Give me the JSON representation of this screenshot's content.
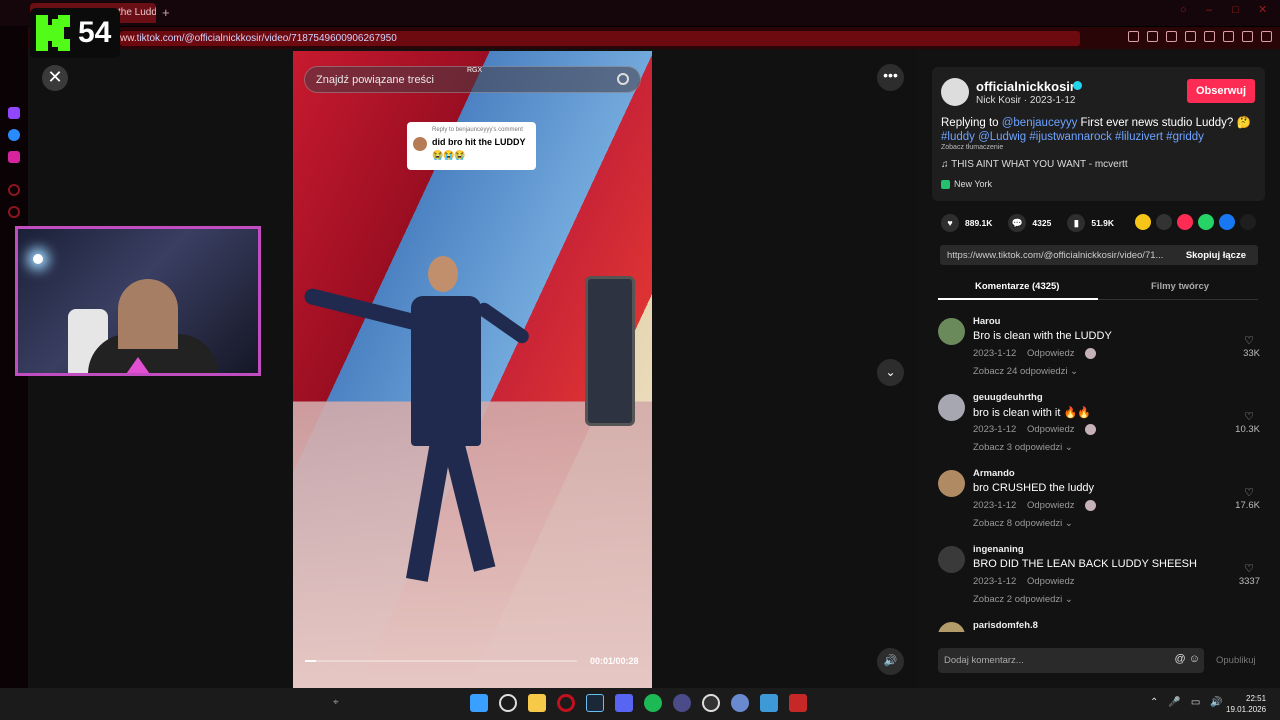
{
  "browser": {
    "tab_title": "the Ludd",
    "url_prefix": "ww.",
    "url_host": "tiktok.com",
    "url_path": "/@officialnickkosir/video/7187549600906267950"
  },
  "overlay": {
    "logo_number": "54"
  },
  "video": {
    "search_placeholder": "Znajdź powiązane treści",
    "search_tag": "RGX",
    "reply_to": "Reply to benjaunceyyy's comment",
    "reply_text": "did bro hit the LUDDY",
    "reply_emoji": "😭😭😭",
    "time": "00:01/00:28",
    "progress": 0.04,
    "close_label": "✕",
    "more_label": "•••",
    "down_label": "⌄",
    "volume_label": "🔊"
  },
  "post": {
    "username": "officialnickkosir",
    "subline": "Nick Kosir · 2023-1-12",
    "follow_label": "Obserwuj",
    "caption_plain": "Replying to ",
    "caption_mention": "@benjauceyyy",
    "caption_rest": " First ever news studio Luddy? 🤔",
    "caption_tags": "#luddy @Ludwig #ijustwannarock #liluzivert #griddy",
    "translate_label": "Zobacz tłumaczenie",
    "music": "♫  THIS AINT WHAT YOU WANT - mcvertt",
    "location": "New York",
    "likes": "889.1K",
    "comments": "4325",
    "saves": "51.9K",
    "link": "https://www.tiktok.com/@officialnickkosir/video/71...",
    "copy_label": "Skopiuj łącze",
    "tab_comments": "Komentarze (4325)",
    "tab_creator": "Filmy twórcy"
  },
  "comments": [
    {
      "user": "Harou",
      "text": "Bro is clean with the LUDDY",
      "date": "2023-1-12",
      "reply": "Odpowiedz",
      "more": "Zobacz 24 odpowiedzi ⌄",
      "likes": "33K"
    },
    {
      "user": "geuugdeuhrthg",
      "text": "bro is clean with it 🔥🔥",
      "date": "2023-1-12",
      "reply": "Odpowiedz",
      "more": "Zobacz 3 odpowiedzi ⌄",
      "likes": "10.3K"
    },
    {
      "user": "Armando",
      "text": "bro CRUSHED the luddy",
      "date": "2023-1-12",
      "reply": "Odpowiedz",
      "more": "Zobacz 8 odpowiedzi ⌄",
      "likes": "17.6K"
    },
    {
      "user": "ingenaning",
      "text": "BRO DID THE LEAN BACK LUDDY SHEESH",
      "date": "2023-1-12",
      "reply": "Odpowiedz",
      "more": "Zobacz 2 odpowiedzi ⌄",
      "likes": "3337"
    },
    {
      "user": "parisdomfeh.8",
      "text": "",
      "date": "",
      "reply": "",
      "more": "",
      "likes": ""
    }
  ],
  "comment_input": {
    "placeholder": "Dodaj komentarz...",
    "publish": "Opublikuj"
  },
  "taskbar": {
    "time": "22:51",
    "date": "19.01.2026"
  },
  "colors": {
    "accent": "#fe2c55",
    "link": "#6ea3ff",
    "browser_red": "#6d0a10"
  }
}
